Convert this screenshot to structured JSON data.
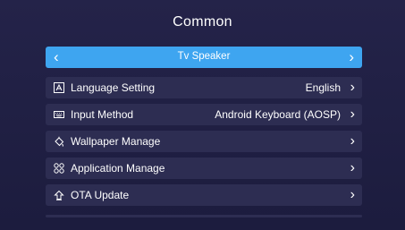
{
  "title": "Common",
  "selected": {
    "label": "Tv Speaker"
  },
  "rows": [
    {
      "label": "Language Setting",
      "value": "English",
      "icon": "language-icon"
    },
    {
      "label": "Input Method",
      "value": "Android Keyboard (AOSP)",
      "icon": "keyboard-icon"
    },
    {
      "label": "Wallpaper Manage",
      "value": "",
      "icon": "wallpaper-icon"
    },
    {
      "label": "Application Manage",
      "value": "",
      "icon": "apps-grid-icon"
    },
    {
      "label": "OTA Update",
      "value": "",
      "icon": "update-icon"
    }
  ],
  "colors": {
    "background": "#1e1d40",
    "row": "#2d2d52",
    "selected": "#3ea5f0"
  }
}
